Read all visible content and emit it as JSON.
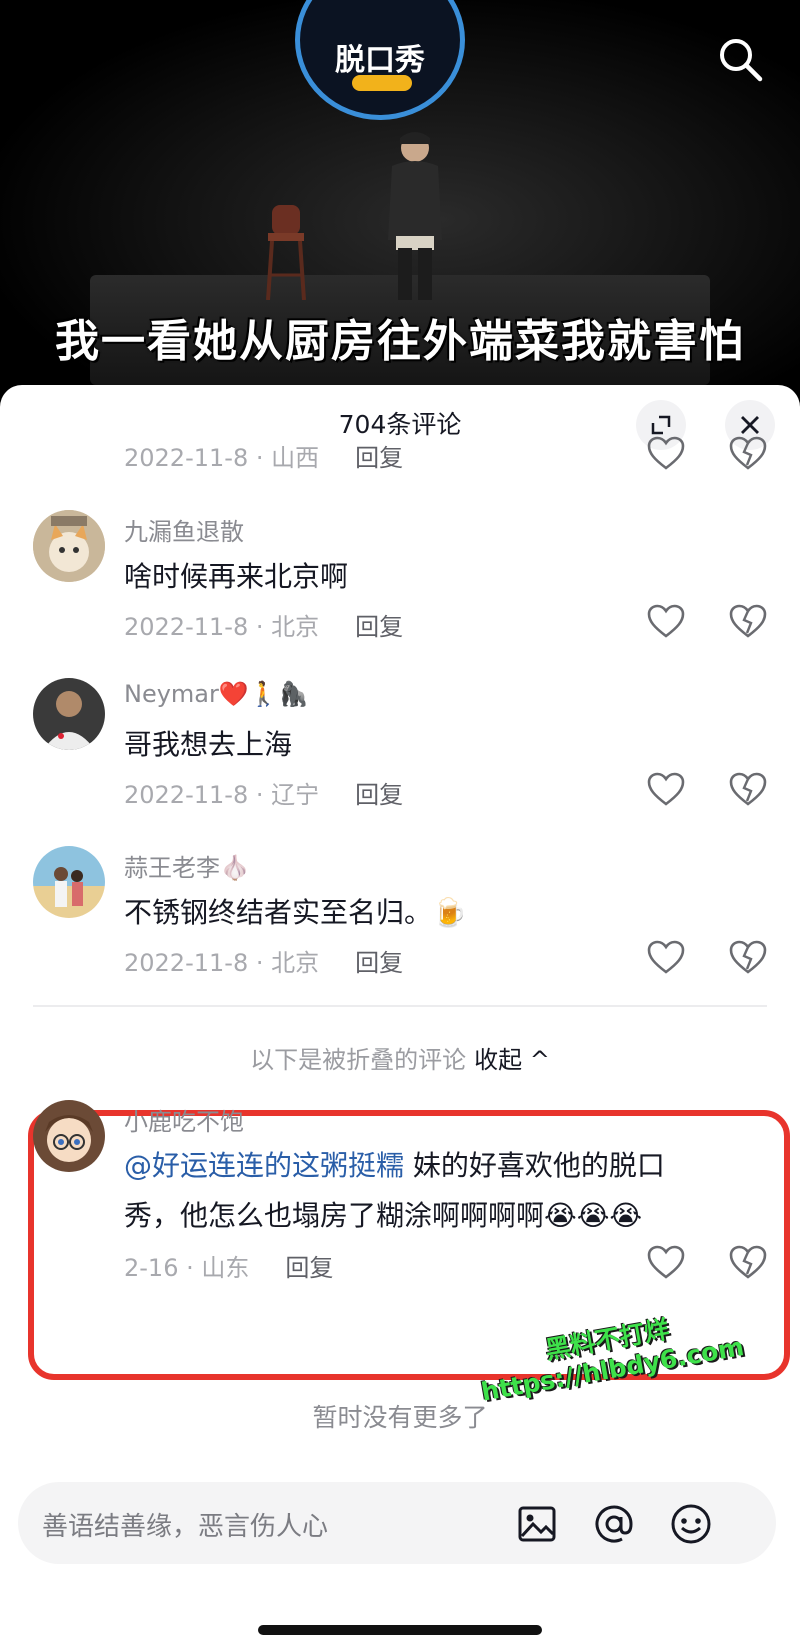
{
  "video": {
    "logo_text": "脱口秀",
    "subtitle": "我一看她从厨房往外端菜我就害怕"
  },
  "sheet": {
    "title": "704条评论"
  },
  "comments": [
    {
      "user": "",
      "text": "",
      "date": "2022-11-8 · 山西",
      "reply": "回复"
    },
    {
      "user": "九漏鱼退散",
      "text": "啥时候再来北京啊",
      "date": "2022-11-8 · 北京",
      "reply": "回复"
    },
    {
      "user": "Neymar❤️🚶🦍",
      "text": "哥我想去上海",
      "date": "2022-11-8 · 辽宁",
      "reply": "回复"
    },
    {
      "user": "蒜王老李🧄",
      "text": "不锈钢终结者实至名归。🍺",
      "date": "2022-11-8 · 北京",
      "reply": "回复"
    }
  ],
  "folded": {
    "text": "以下是被折叠的评论",
    "action": "收起 ^"
  },
  "folded_comment": {
    "user": "小鹿吃不饱",
    "mention": "@好运连连的这粥挺糯",
    "text_line1": " 妹的好喜欢他的脱口",
    "text_line2": "秀，他怎么也塌房了糊涂啊啊啊啊😭😭😭",
    "date": "2-16 · 山东",
    "reply": "回复"
  },
  "no_more": "暂时没有更多了",
  "watermark": {
    "line1": "黑料不打烊",
    "line2": "https://hlbdy6.com"
  },
  "input": {
    "placeholder": "善语结善缘，恶言伤人心"
  },
  "colors": {
    "highlight_border": "#e8342c",
    "mention": "#2a5ea8",
    "watermark": "#3ee14a"
  }
}
